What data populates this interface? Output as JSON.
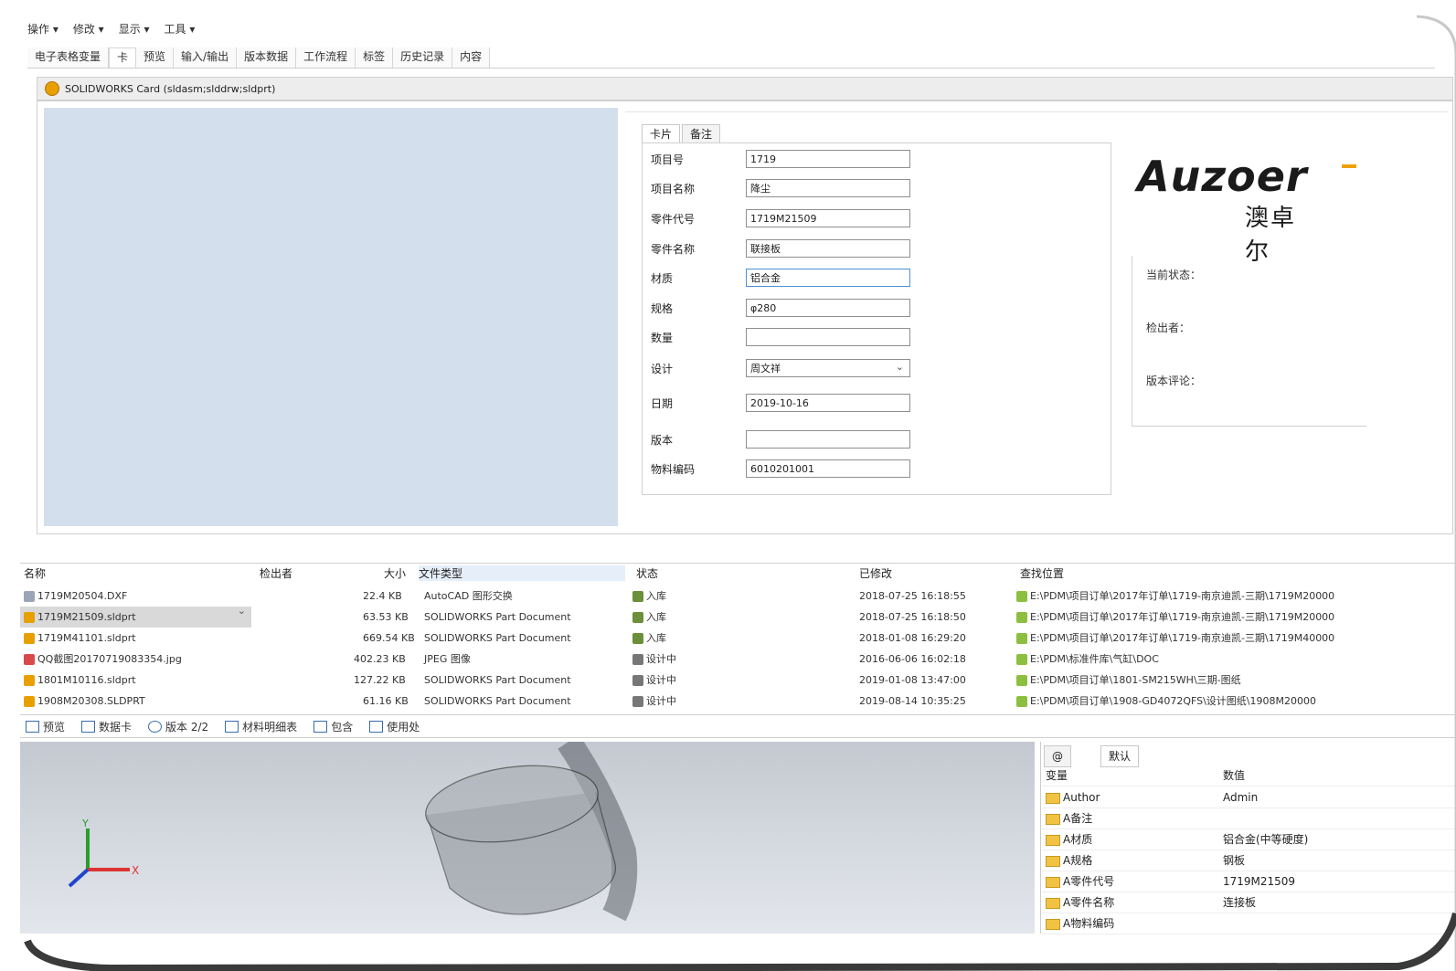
{
  "menu": [
    "操作 ▾",
    "修改 ▾",
    "显示 ▾",
    "工具 ▾"
  ],
  "tabs": [
    "电子表格变量",
    "卡",
    "预览",
    "输入/输出",
    "版本数据",
    "工作流程",
    "标签",
    "历史记录",
    "内容"
  ],
  "card_title": "SOLIDWORKS Card  (sldasm;slddrw;sldprt)",
  "form": {
    "tabs": [
      "卡片",
      "备注"
    ],
    "fields": [
      {
        "label": "项目号",
        "value": "1719"
      },
      {
        "label": "项目名称",
        "value": "降尘"
      },
      {
        "label": "零件代号",
        "value": "1719M21509"
      },
      {
        "label": "零件名称",
        "value": "联接板"
      },
      {
        "label": "材质",
        "value": "铝合金"
      },
      {
        "label": "规格",
        "value": "φ280"
      },
      {
        "label": "数量",
        "value": ""
      },
      {
        "label": "设计",
        "value": "周文祥"
      },
      {
        "label": "日期",
        "value": "2019-10-16"
      },
      {
        "label": "版本",
        "value": ""
      },
      {
        "label": "物料编码",
        "value": "6010201001"
      }
    ]
  },
  "logo": {
    "en": "Auzoer",
    "cn": "澳卓尔"
  },
  "status": [
    "当前状态：",
    "检出者：",
    "版本评论："
  ],
  "file_list": {
    "headers": [
      "名称",
      "检出者",
      "大小",
      "文件类型",
      "状态",
      "已修改",
      "查找位置"
    ],
    "rows": [
      {
        "name": "1719M20504.DXF",
        "size": "22.4 KB",
        "type": "AutoCAD 图形交换",
        "state": "入库",
        "modified": "2018-07-25 16:18:55",
        "path": "E:\\PDM\\项目订单\\2017年订单\\1719-南京迪凯-三期\\1719M20000"
      },
      {
        "name": "1719M21509.sldprt",
        "size": "63.53 KB",
        "type": "SOLIDWORKS Part Document",
        "state": "入库",
        "modified": "2018-07-25 16:18:50",
        "path": "E:\\PDM\\项目订单\\2017年订单\\1719-南京迪凯-三期\\1719M20000"
      },
      {
        "name": "1719M41101.sldprt",
        "size": "669.54 KB",
        "type": "SOLIDWORKS Part Document",
        "state": "入库",
        "modified": "2018-01-08 16:29:20",
        "path": "E:\\PDM\\项目订单\\2017年订单\\1719-南京迪凯-三期\\1719M40000"
      },
      {
        "name": "QQ截图20170719083354.jpg",
        "size": "402.23 KB",
        "type": "JPEG 图像",
        "state": "设计中",
        "modified": "2016-06-06 16:02:18",
        "path": "E:\\PDM\\标准件库\\气缸\\DOC"
      },
      {
        "name": "1801M10116.sldprt",
        "size": "127.22 KB",
        "type": "SOLIDWORKS Part Document",
        "state": "设计中",
        "modified": "2019-01-08 13:47:00",
        "path": "E:\\PDM\\项目订单\\1801-SM215WH\\三期-图纸"
      },
      {
        "name": "1908M20308.SLDPRT",
        "size": "61.16 KB",
        "type": "SOLIDWORKS Part Document",
        "state": "设计中",
        "modified": "2019-08-14 10:35:25",
        "path": "E:\\PDM\\项目订单\\1908-GD4072QFS\\设计图纸\\1908M20000"
      }
    ]
  },
  "bottom_tabs": [
    "预览",
    "数据卡",
    "版本 2/2",
    "材料明细表",
    "包含",
    "使用处"
  ],
  "properties": {
    "tabs": [
      "@",
      "默认"
    ],
    "headers": [
      "变量",
      "数值"
    ],
    "rows": [
      {
        "name": "Author",
        "value": "Admin"
      },
      {
        "name": "A备注",
        "value": ""
      },
      {
        "name": "A材质",
        "value": "铝合金(中等硬度)"
      },
      {
        "name": "A规格",
        "value": "钢板"
      },
      {
        "name": "A零件代号",
        "value": "1719M21509"
      },
      {
        "name": "A零件名称",
        "value": "连接板"
      },
      {
        "name": "A物料编码",
        "value": ""
      }
    ]
  },
  "colors": {
    "form_bg": "#d4dfee",
    "accent": "#f0a000"
  }
}
